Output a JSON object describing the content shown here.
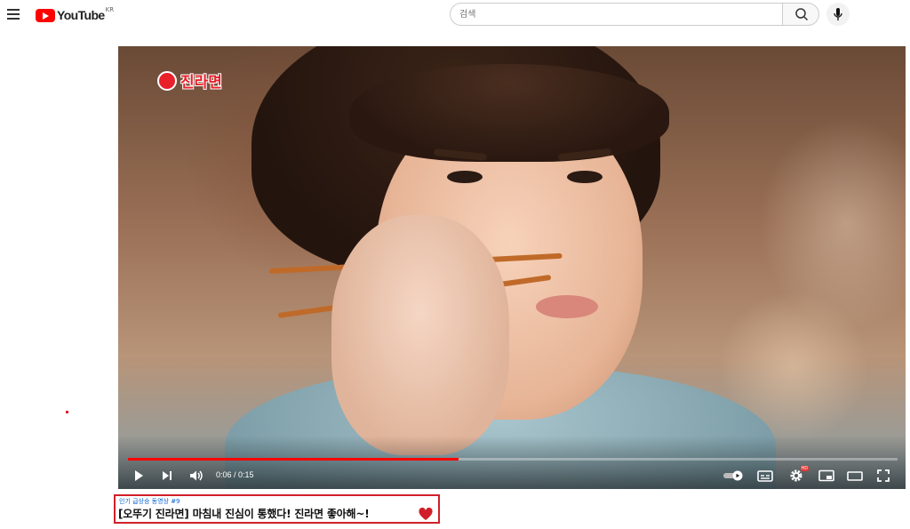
{
  "header": {
    "logo_text": "YouTube",
    "region": "KR",
    "search_placeholder": "검색"
  },
  "player": {
    "brand_text": "진라면",
    "time_display": "0:06 / 0:15",
    "progress_fraction": 0.43,
    "settings_badge": "HD"
  },
  "video": {
    "hashtag": "인기 급상승 동영상 #9",
    "title": "[오뚜기 진라면] 마침내 진심이 통했다! 진라면 좋아해~!"
  },
  "colors": {
    "accent": "#ff0000",
    "brand_red": "#e8212b",
    "link_blue": "#065fd4",
    "highlight_border": "#d0202a"
  },
  "icons": [
    "menu-icon",
    "youtube-logo-icon",
    "search-icon",
    "mic-icon",
    "play-icon",
    "next-icon",
    "volume-icon",
    "autoplay-toggle-icon",
    "captions-icon",
    "settings-icon",
    "miniplayer-icon",
    "theater-icon",
    "fullscreen-icon",
    "heart-icon"
  ]
}
